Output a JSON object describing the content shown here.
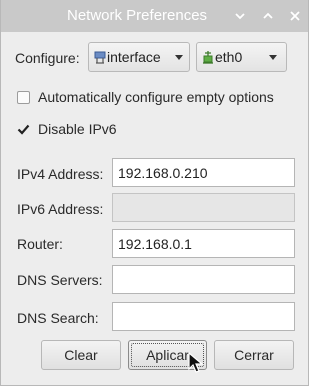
{
  "window": {
    "title": "Network Preferences"
  },
  "configure": {
    "label": "Configure:",
    "type_value": "interface",
    "device_value": "eth0"
  },
  "options": {
    "auto_configure_label": "Automatically configure empty options",
    "auto_configure_checked": false,
    "disable_ipv6_label": "Disable IPv6",
    "disable_ipv6_checked": true
  },
  "fields": {
    "ipv4": {
      "label": "IPv4 Address:",
      "value": "192.168.0.210"
    },
    "ipv6": {
      "label": "IPv6 Address:",
      "value": ""
    },
    "router": {
      "label": "Router:",
      "value": "192.168.0.1"
    },
    "dns_servers": {
      "label": "DNS Servers:",
      "value": ""
    },
    "dns_search": {
      "label": "DNS Search:",
      "value": ""
    }
  },
  "buttons": {
    "clear": "Clear",
    "apply": "Aplicar",
    "close": "Cerrar"
  },
  "icons": {
    "interface": "network-interface-icon",
    "device": "ethernet-device-icon",
    "minimize": "minimize-icon",
    "maximize": "maximize-icon",
    "close": "close-icon",
    "pointer": "mouse-pointer-icon"
  },
  "colors": {
    "titlebar": "#c9c9c9",
    "window_bg": "#ededed"
  }
}
